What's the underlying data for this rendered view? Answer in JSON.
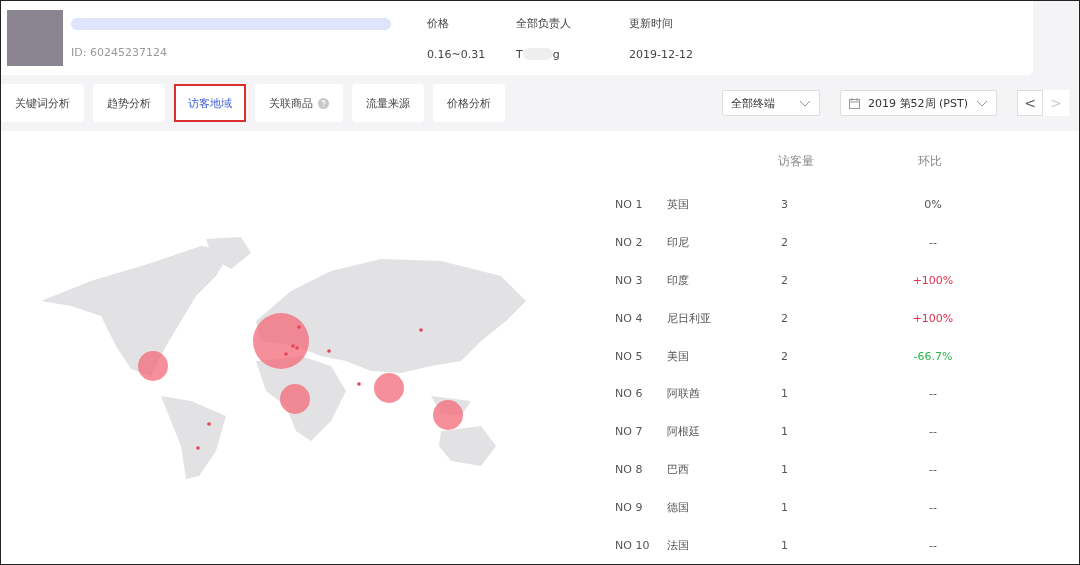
{
  "product": {
    "id": "ID: 60245237124",
    "price_label": "价格",
    "price": "0.16~0.31",
    "owner_label": "全部负责人",
    "owner_start": "T",
    "owner_end": "g",
    "updated_label": "更新时间",
    "updated": "2019-12-12"
  },
  "tabs": [
    {
      "label": "关键词分析",
      "selected": false,
      "help": false
    },
    {
      "label": "趋势分析",
      "selected": false,
      "help": false
    },
    {
      "label": "访客地域",
      "selected": true,
      "help": false
    },
    {
      "label": "关联商品",
      "selected": false,
      "help": true
    },
    {
      "label": "流量来源",
      "selected": false,
      "help": false
    },
    {
      "label": "价格分析",
      "selected": false,
      "help": false
    }
  ],
  "terminal_select": {
    "value": "全部终端"
  },
  "week_select": {
    "value": "2019 第52周 (PST)"
  },
  "prev_button": {
    "label": "<",
    "disabled": false
  },
  "next_button": {
    "label": ">",
    "disabled": true
  },
  "table": {
    "columns": [
      "访客量",
      "环比"
    ],
    "rows": [
      {
        "rank": "NO 1",
        "country": "英国",
        "visitors": "3",
        "change": "0%",
        "color": "#555555"
      },
      {
        "rank": "NO 2",
        "country": "印尼",
        "visitors": "2",
        "change": "--"
      },
      {
        "rank": "NO 3",
        "country": "印度",
        "visitors": "2",
        "change": "+100%",
        "color": "#e0304f"
      },
      {
        "rank": "NO 4",
        "country": "尼日利亚",
        "visitors": "2",
        "change": "+100%",
        "color": "#e0304f"
      },
      {
        "rank": "NO 5",
        "country": "美国",
        "visitors": "2",
        "change": "-66.7%",
        "color": "#2bb24c"
      },
      {
        "rank": "NO 6",
        "country": "阿联酋",
        "visitors": "1",
        "change": "--"
      },
      {
        "rank": "NO 7",
        "country": "阿根廷",
        "visitors": "1",
        "change": "--"
      },
      {
        "rank": "NO 8",
        "country": "巴西",
        "visitors": "1",
        "change": "--"
      },
      {
        "rank": "NO 9",
        "country": "德国",
        "visitors": "1",
        "change": "--"
      },
      {
        "rank": "NO 10",
        "country": "法国",
        "visitors": "1",
        "change": "--"
      }
    ]
  }
}
